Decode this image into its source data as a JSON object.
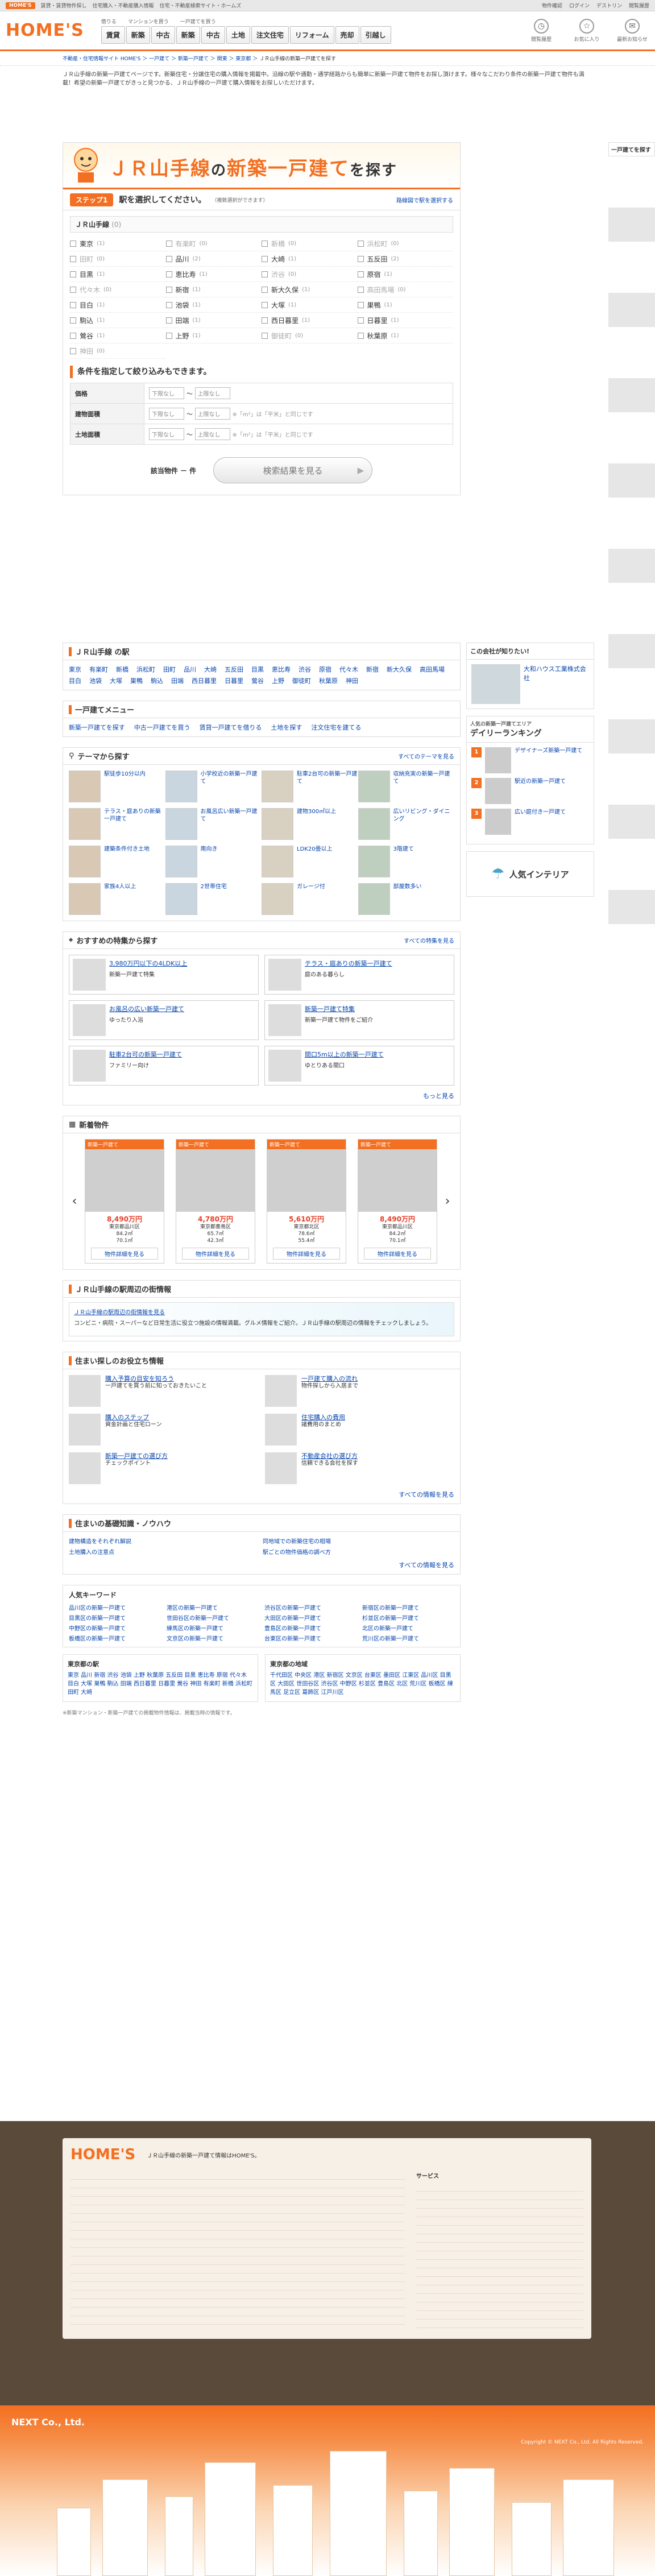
{
  "topbar": {
    "brand": "HOME'S",
    "links": [
      "賃貸・賃貸物件探し",
      "住宅購入・不動産購入情報",
      "住宅・不動産検索サイト・ホームズ"
    ],
    "right": [
      "物件確認",
      "ログイン",
      "デストリン",
      "閲覧履歴"
    ]
  },
  "header": {
    "brand": "HOME'S",
    "nav_caption": [
      "借りる",
      "マンションを買う",
      "一戸建てを買う"
    ],
    "nav": [
      "賃貸",
      "新築",
      "中古",
      "新築",
      "中古",
      "土地",
      "注文住宅",
      "リフォーム",
      "売却",
      "引越し"
    ],
    "icons": [
      {
        "icon": "clock-icon",
        "label": "閲覧履歴"
      },
      {
        "icon": "star-icon",
        "label": "お気に入り"
      },
      {
        "icon": "chat-icon",
        "label": "最新お知らせ"
      }
    ]
  },
  "breadcrumb": [
    "不動産・住宅情報サイト HOME'S",
    "一戸建て",
    "新築一戸建て",
    "関東",
    "東京都",
    "ＪＲ山手線の新築一戸建てを探す"
  ],
  "intro": "ＪＲ山手線の新築一戸建てページです。新築住宅・分譲住宅の購入情報を掲載中。沿線の駅や通勤・通学経路からも簡単に新築一戸建て物件をお探し頂けます。様々なこだわり条件の新築一戸建て物件も満載！希望の新築一戸建てがきっと見つかる、ＪＲ山手線の一戸建て購入情報をお探しいただけます。",
  "hero": {
    "prefix": "ＪＲ山手線",
    "mid": "の",
    "title": "新築一戸建て",
    "suffix": "を探す"
  },
  "step": {
    "label": "ステップ1",
    "text": "駅を選択してください。",
    "note": "（複数選択ができます）",
    "right": "路線図で駅を選択する"
  },
  "line": {
    "name": "ＪＲ山手線",
    "count": "(0)"
  },
  "stations": [
    {
      "n": "東京",
      "c": "(1)",
      "d": false
    },
    {
      "n": "有楽町",
      "c": "(0)",
      "d": true
    },
    {
      "n": "新橋",
      "c": "(0)",
      "d": true
    },
    {
      "n": "浜松町",
      "c": "(0)",
      "d": true
    },
    {
      "n": "田町",
      "c": "(0)",
      "d": true
    },
    {
      "n": "品川",
      "c": "(2)",
      "d": false
    },
    {
      "n": "大崎",
      "c": "(1)",
      "d": false
    },
    {
      "n": "五反田",
      "c": "(2)",
      "d": false
    },
    {
      "n": "目黒",
      "c": "(1)",
      "d": false
    },
    {
      "n": "恵比寿",
      "c": "(1)",
      "d": false
    },
    {
      "n": "渋谷",
      "c": "(0)",
      "d": true
    },
    {
      "n": "原宿",
      "c": "(1)",
      "d": false
    },
    {
      "n": "代々木",
      "c": "(0)",
      "d": true
    },
    {
      "n": "新宿",
      "c": "(1)",
      "d": false
    },
    {
      "n": "新大久保",
      "c": "(1)",
      "d": false
    },
    {
      "n": "高田馬場",
      "c": "(0)",
      "d": true
    },
    {
      "n": "目白",
      "c": "(1)",
      "d": false
    },
    {
      "n": "池袋",
      "c": "(1)",
      "d": false
    },
    {
      "n": "大塚",
      "c": "(1)",
      "d": false
    },
    {
      "n": "巣鴨",
      "c": "(1)",
      "d": false
    },
    {
      "n": "駒込",
      "c": "(1)",
      "d": false
    },
    {
      "n": "田端",
      "c": "(1)",
      "d": false
    },
    {
      "n": "西日暮里",
      "c": "(1)",
      "d": false
    },
    {
      "n": "日暮里",
      "c": "(1)",
      "d": false
    },
    {
      "n": "鶯谷",
      "c": "(1)",
      "d": false
    },
    {
      "n": "上野",
      "c": "(1)",
      "d": false
    },
    {
      "n": "御徒町",
      "c": "(0)",
      "d": true
    },
    {
      "n": "秋葉原",
      "c": "(1)",
      "d": false
    },
    {
      "n": "神田",
      "c": "(0)",
      "d": true
    }
  ],
  "conditions": {
    "title": "条件を指定して絞り込みもできます。",
    "rows": [
      {
        "label": "価格",
        "a": "下限なし",
        "b": "上限なし",
        "note": ""
      },
      {
        "label": "建物面積",
        "a": "下限なし",
        "b": "上限なし",
        "note": "※「m²」は「平米」と同じです"
      },
      {
        "label": "土地面積",
        "a": "下限なし",
        "b": "上限なし",
        "note": "※「m²」は「平米」と同じです"
      }
    ]
  },
  "result": {
    "count_label": "該当物件 － 件",
    "button": "検索結果を見る"
  },
  "stations_box": {
    "title": "ＪＲ山手線 の駅",
    "items": [
      "東京",
      "有楽町",
      "新橋",
      "浜松町",
      "田町",
      "品川",
      "大崎",
      "五反田",
      "目黒",
      "恵比寿",
      "渋谷",
      "原宿",
      "代々木",
      "新宿",
      "新大久保",
      "高田馬場",
      "目白",
      "池袋",
      "大塚",
      "巣鴨",
      "駒込",
      "田端",
      "西日暮里",
      "日暮里",
      "鶯谷",
      "上野",
      "御徒町",
      "秋葉原",
      "神田"
    ]
  },
  "menu": {
    "title": "一戸建てメニュー",
    "items": [
      "新築一戸建てを探す",
      "中古一戸建てを買う",
      "賃貸一戸建てを借りる",
      "土地を探す",
      "注文住宅を建てる"
    ]
  },
  "themes": {
    "title": "テーマから探す",
    "more": "すべてのテーマを見る",
    "items": [
      "駅徒歩10分以内",
      "小学校近の新築一戸建て",
      "駐車2台可の新築一戸建て",
      "収納充実の新築一戸建て",
      "テラス・庭ありの新築一戸建て",
      "お風呂広い新築一戸建て",
      "建物300㎡以上",
      "広いリビング・ダイニング",
      "建築条件付き土地",
      "南向き",
      "LDK20畳以上",
      "3階建て",
      "家族4人以上",
      "2世帯住宅",
      "ガレージ付",
      "部屋数多い"
    ]
  },
  "features": {
    "title": "おすすめの特集から探す",
    "more": "すべての特集を見る",
    "items": [
      {
        "t": "3,980万円以下の4LDK以上",
        "d": "新築一戸建て特集"
      },
      {
        "t": "テラス・庭ありの新築一戸建て",
        "d": "庭のある暮らし"
      },
      {
        "t": "お風呂の広い新築一戸建て",
        "d": "ゆったり入浴"
      },
      {
        "t": "新築一戸建て特集",
        "d": "新築一戸建て物件をご紹介"
      },
      {
        "t": "駐車2台可の新築一戸建て",
        "d": "ファミリー向け"
      },
      {
        "t": "間口5m以上の新築一戸建て",
        "d": "ゆとりある間口"
      }
    ],
    "more2": "もっと見る"
  },
  "new": {
    "title": "新着物件",
    "cards": [
      {
        "price": "8,490万円",
        "name": "東京都品川区",
        "area": "84.2㎡",
        "land": "70.1㎡"
      },
      {
        "price": "4,780万円",
        "name": "東京都豊島区",
        "area": "65.7㎡",
        "land": "42.3㎡"
      },
      {
        "price": "5,610万円",
        "name": "東京都北区",
        "area": "78.6㎡",
        "land": "55.4㎡"
      },
      {
        "price": "8,490万円",
        "name": "東京都品川区",
        "area": "84.2㎡",
        "land": "70.1㎡"
      }
    ],
    "detail": "物件詳細を見る"
  },
  "info": {
    "title": "ＪＲ山手線の駅周辺の街情報",
    "link": "ＪＲ山手線の駅周辺の街情報を見る",
    "desc": "コンビニ・病院・スーパーなど日常生活に役立つ施設の情報満載。グルメ情報をご紹介。ＪＲ山手線の駅周辺の情報をチェックしましょう。"
  },
  "tips": {
    "title": "住まい探しのお役立ち情報",
    "more": "すべての情報を見る",
    "items": [
      {
        "t": "購入予算の目安を知ろう",
        "d": "一戸建てを買う前に知っておきたいこと"
      },
      {
        "t": "一戸建て購入の流れ",
        "d": "物件探しから入居まで"
      },
      {
        "t": "購入のステップ",
        "d": "資金計画と住宅ローン"
      },
      {
        "t": "住宅購入の費用",
        "d": "諸費用のまとめ"
      },
      {
        "t": "新築一戸建ての選び方",
        "d": "チェックポイント"
      },
      {
        "t": "不動産会社の選び方",
        "d": "信頼できる会社を探す"
      }
    ]
  },
  "basics": {
    "title": "住まいの基礎知識・ノウハウ",
    "more": "すべての情報を見る",
    "items": [
      "建物構造をそれぞれ解説",
      "同地域での新築住宅の相場",
      "土地購入の注意点",
      "駅ごとの物件価格の調べ方"
    ]
  },
  "keywords": {
    "title": "人気キーワード",
    "items": [
      "品川区の新築一戸建て",
      "港区の新築一戸建て",
      "渋谷区の新築一戸建て",
      "新宿区の新築一戸建て",
      "目黒区の新築一戸建て",
      "世田谷区の新築一戸建て",
      "大田区の新築一戸建て",
      "杉並区の新築一戸建て",
      "中野区の新築一戸建て",
      "練馬区の新築一戸建て",
      "豊島区の新築一戸建て",
      "北区の新築一戸建て",
      "板橋区の新築一戸建て",
      "文京区の新築一戸建て",
      "台東区の新築一戸建て",
      "荒川区の新築一戸建て"
    ]
  },
  "areas": {
    "left": {
      "title": "東京都の駅",
      "links": "東京 品川 新宿 渋谷 池袋 上野 秋葉原 五反田 目黒 恵比寿 原宿 代々木 目白 大塚 巣鴨 駒込 田端 西日暮里 日暮里 鶯谷 神田 有楽町 新橋 浜松町 田町 大崎"
    },
    "right": {
      "title": "東京都の地域",
      "links": "千代田区 中央区 港区 新宿区 文京区 台東区 墨田区 江東区 品川区 目黒区 大田区 世田谷区 渋谷区 中野区 杉並区 豊島区 北区 荒川区 板橋区 練馬区 足立区 葛飾区 江戸川区"
    }
  },
  "disclaimer": "※新築マンション・新築一戸建ての掲載物件情報は、掲載当時の情報です。",
  "side": {
    "ad_title": "この会社が知りたい!",
    "ad_company": "大和ハウス工業株式会社",
    "rank_title": "デイリーランキング",
    "rank_sub": "人気の新築一戸建てエリア",
    "rank": [
      {
        "n": "1",
        "t": "デザイナーズ新築一戸建て"
      },
      {
        "n": "2",
        "t": "駅近の新築一戸建て"
      },
      {
        "n": "3",
        "t": "広い庭付き一戸建て"
      }
    ],
    "interior": "人気インテリア"
  },
  "rstrip": {
    "title": "一戸建てを探す"
  },
  "footer": {
    "brand": "HOME'S",
    "text": "ＪＲ山手線の新築一戸建て情報はHOME'S。",
    "services": "サービス",
    "copy": "Copyright © NEXT Co., Ltd. All Rights Reserved.",
    "company": "NEXT Co., Ltd."
  }
}
